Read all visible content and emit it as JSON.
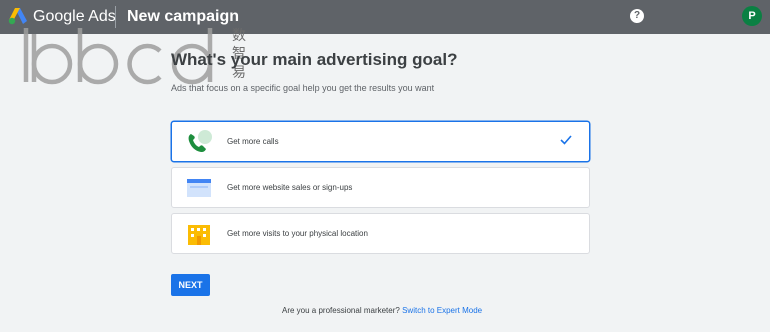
{
  "header": {
    "brand": "Google Ads",
    "title": "New campaign",
    "help_icon": "?",
    "avatar_letter": "P",
    "icons": [
      "google-ads-logo-icon",
      "help-icon",
      "avatar"
    ],
    "colors": {
      "bar": "#5f6368",
      "avatar": "#0b8043"
    }
  },
  "watermark": {
    "latin": "iabcd",
    "cjk": [
      "数",
      "智",
      "易"
    ]
  },
  "main": {
    "heading": "What's your main advertising goal?",
    "subheading": "Ads that focus on a specific goal help you get the results you want",
    "goals": [
      {
        "label": "Get more calls",
        "icon": "phone-icon",
        "selected": true
      },
      {
        "label": "Get more website sales or sign-ups",
        "icon": "browser-window-icon",
        "selected": false
      },
      {
        "label": "Get more visits to your physical location",
        "icon": "storefront-icon",
        "selected": false
      }
    ],
    "next_label": "NEXT"
  },
  "footer": {
    "text": "Are you a professional marketer?",
    "link": "Switch to Expert Mode"
  },
  "colors": {
    "accent": "#1a73e8"
  }
}
